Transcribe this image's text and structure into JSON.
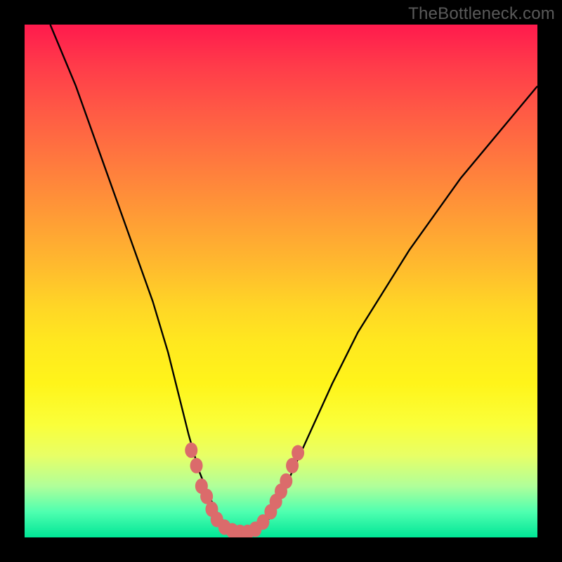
{
  "watermark": "TheBottleneck.com",
  "colors": {
    "background_black": "#000000",
    "gradient_top": "#ff1a4d",
    "gradient_bottom": "#00e696",
    "curve_stroke": "#000000",
    "marker_fill": "#db6b6b"
  },
  "chart_data": {
    "type": "line",
    "title": "",
    "xlabel": "",
    "ylabel": "",
    "xlim": [
      0,
      100
    ],
    "ylim": [
      0,
      100
    ],
    "grid": false,
    "legend": false,
    "annotations": [
      "TheBottleneck.com"
    ],
    "series": [
      {
        "name": "bottleneck-curve",
        "x": [
          5,
          10,
          15,
          20,
          25,
          28,
          30,
          32,
          34,
          36,
          38,
          40,
          42,
          44,
          46,
          48,
          50,
          55,
          60,
          65,
          70,
          75,
          80,
          85,
          90,
          95,
          100
        ],
        "y": [
          100,
          88,
          74,
          60,
          46,
          36,
          28,
          20,
          13,
          8,
          4,
          2,
          1,
          1,
          2,
          4,
          8,
          19,
          30,
          40,
          48,
          56,
          63,
          70,
          76,
          82,
          88
        ]
      }
    ],
    "markers": [
      {
        "name": "left-upper-1",
        "x": 32.5,
        "y": 17
      },
      {
        "name": "left-upper-2",
        "x": 33.5,
        "y": 14
      },
      {
        "name": "left-mid-1",
        "x": 34.5,
        "y": 10
      },
      {
        "name": "left-mid-2",
        "x": 35.5,
        "y": 8
      },
      {
        "name": "left-low-1",
        "x": 36.5,
        "y": 5.5
      },
      {
        "name": "left-low-2",
        "x": 37.5,
        "y": 3.5
      },
      {
        "name": "trough-l1",
        "x": 39,
        "y": 2
      },
      {
        "name": "trough-l2",
        "x": 40.5,
        "y": 1.3
      },
      {
        "name": "trough-c1",
        "x": 42,
        "y": 1
      },
      {
        "name": "trough-c2",
        "x": 43.5,
        "y": 1
      },
      {
        "name": "trough-r1",
        "x": 45,
        "y": 1.6
      },
      {
        "name": "trough-r2",
        "x": 46.5,
        "y": 3
      },
      {
        "name": "right-low-1",
        "x": 48,
        "y": 5
      },
      {
        "name": "right-low-2",
        "x": 49,
        "y": 7
      },
      {
        "name": "right-mid-1",
        "x": 50,
        "y": 9
      },
      {
        "name": "right-mid-2",
        "x": 51,
        "y": 11
      },
      {
        "name": "right-upper-1",
        "x": 52.2,
        "y": 14
      },
      {
        "name": "right-upper-2",
        "x": 53.3,
        "y": 16.5
      }
    ]
  }
}
